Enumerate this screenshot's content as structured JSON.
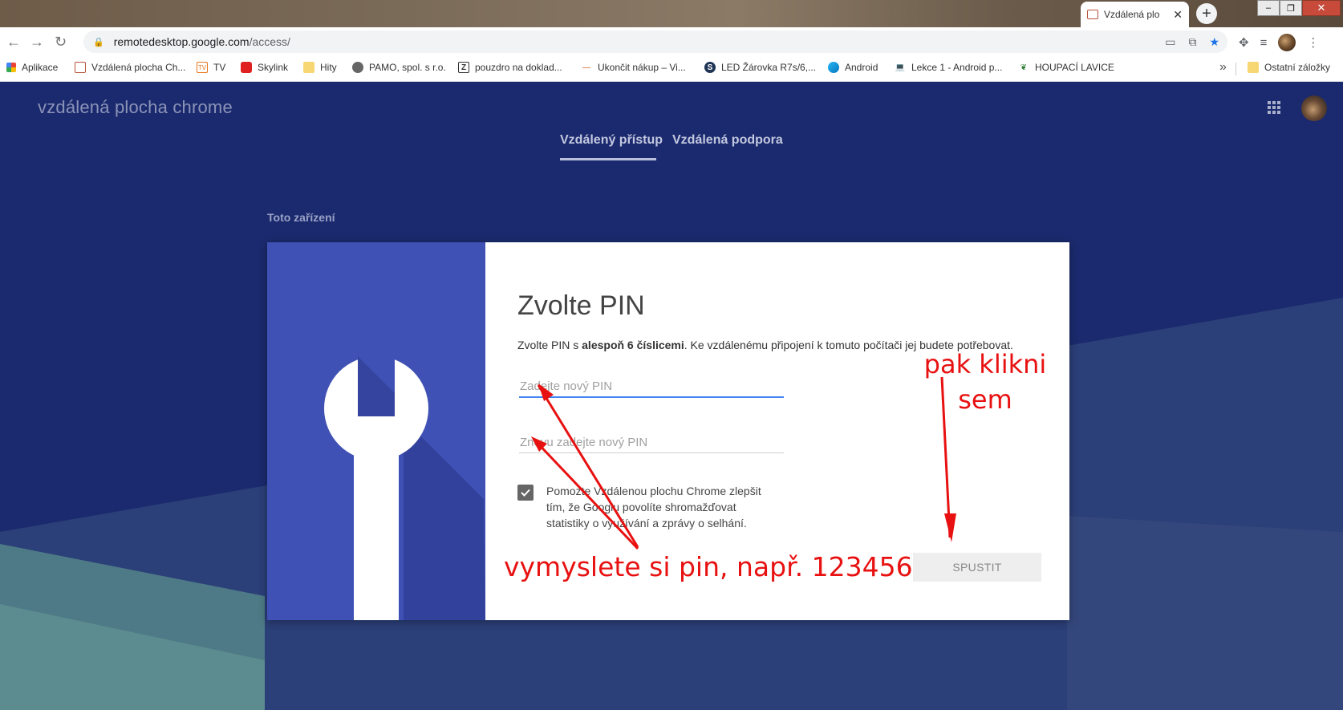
{
  "browser": {
    "tab_title": "Vzdálená plo",
    "new_tab_label": "+",
    "close_tab_label": "✕",
    "url_host": "remotedesktop.google.com",
    "url_path": "/access/",
    "window_controls": {
      "minimize": "–",
      "maximize": "❐",
      "close": "✕"
    }
  },
  "bookmarks": [
    {
      "label": "Aplikace",
      "icon": "apps-grid-icon"
    },
    {
      "label": "Vzdálená plocha Ch...",
      "icon": "remote-desktop-icon"
    },
    {
      "label": "TV",
      "icon": "tv-icon"
    },
    {
      "label": "Skylink",
      "icon": "skylink-icon"
    },
    {
      "label": "Hity",
      "icon": "folder-icon"
    },
    {
      "label": "PAMO, spol. s r.o.",
      "icon": "globe-icon"
    },
    {
      "label": "pouzdro na doklad...",
      "icon": "z-icon"
    },
    {
      "label": "Ukončit nákup – Vi...",
      "icon": "dash-icon"
    },
    {
      "label": "LED Žárovka R7s/6,...",
      "icon": "s-icon"
    },
    {
      "label": "Android",
      "icon": "android-icon"
    },
    {
      "label": "Lekce 1 - Android p...",
      "icon": "laptop-icon"
    },
    {
      "label": "HOUPACÍ LAVICE",
      "icon": "leaf-icon"
    }
  ],
  "bookmarks_more": "»",
  "other_bookmarks": "Ostatní záložky",
  "app": {
    "title": "vzdálená plocha chrome",
    "tabs": [
      "Vzdálený přístup",
      "Vzdálená podpora"
    ],
    "section_title": "Toto zařízení"
  },
  "pin_dialog": {
    "title": "Zvolte PIN",
    "desc_prefix": "Zvolte PIN s ",
    "desc_bold": "alespoň 6 číslicemi",
    "desc_suffix": ". Ke vzdálenému připojení k tomuto počítači jej budete potřebovat.",
    "pin_placeholder": "Zadejte nový PIN",
    "pin_confirm_placeholder": "Znovu zadejte nový PIN",
    "consent_checked": true,
    "consent_text": "Pomozte Vzdálenou plochu Chrome zlepšit tím, že Googlu povolíte shromažďovat statistiky o využívání a zprávy o selhání.",
    "start_button": "SPUSTIT"
  },
  "annotations": {
    "click_here_line1": "pak klikni",
    "click_here_line2": "sem",
    "pin_hint": "vymyslete si pin, např. 123456",
    "color": "#e81111"
  },
  "colors": {
    "page_bg": "#1b2a6e",
    "card_left": "#3f51b5",
    "focus_line": "#4285f4"
  }
}
